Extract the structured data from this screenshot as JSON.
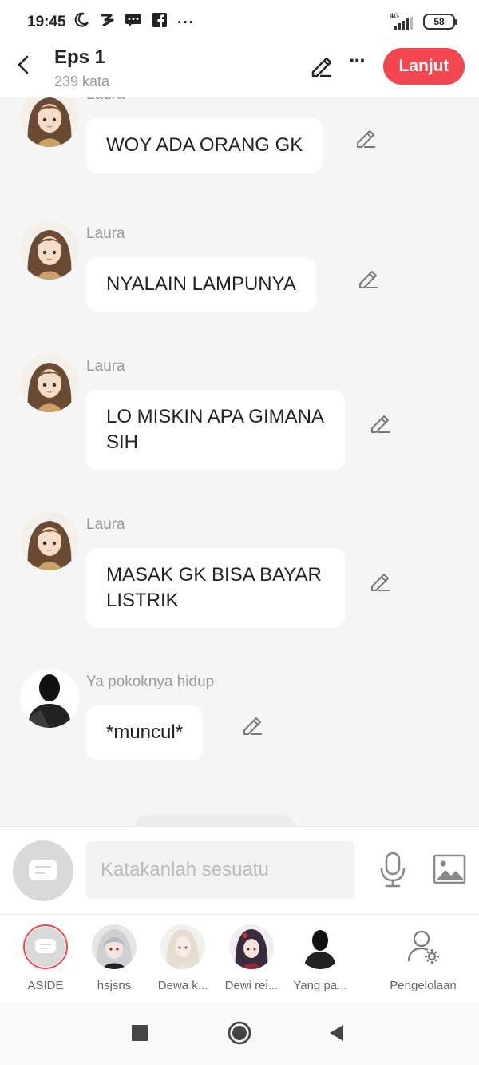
{
  "status_bar": {
    "time": "19:45",
    "network": "4G",
    "battery": "58",
    "icons": [
      "moon-icon",
      "app-icon",
      "message-icon",
      "facebook-icon",
      "more-icon"
    ]
  },
  "header": {
    "title": "Eps 1",
    "word_count": "239 kata",
    "next_label": "Lanjut",
    "accent_color": "#f2474f"
  },
  "messages": [
    {
      "speaker": "Laura",
      "text": "WOY ADA ORANG GK",
      "avatar": "girl-avatar"
    },
    {
      "speaker": "Laura",
      "text": "NYALAIN LAMPUNYA",
      "avatar": "girl-avatar"
    },
    {
      "speaker": "Laura",
      "text": "LO MISKIN APA GIMANA SIH",
      "avatar": "girl-avatar"
    },
    {
      "speaker": "Laura",
      "text": "MASAK GK BISA BAYAR LISTRIK",
      "avatar": "girl-avatar"
    },
    {
      "speaker": "Ya pokoknya hidup",
      "text": "*muncul*",
      "avatar": "silhouette-avatar"
    }
  ],
  "composer": {
    "placeholder": "Katakanlah sesuatu"
  },
  "characters": [
    {
      "name": "ASIDE"
    },
    {
      "name": "hsjsns"
    },
    {
      "name": "Dewa k..."
    },
    {
      "name": "Dewi rei..."
    },
    {
      "name": "Yang pa..."
    },
    {
      "name": "Pengelolaan"
    }
  ]
}
